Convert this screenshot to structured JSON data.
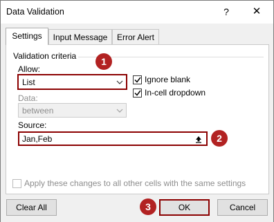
{
  "window": {
    "title": "Data Validation",
    "help": "?",
    "close": "✕"
  },
  "tabs": [
    {
      "label": "Settings",
      "active": true
    },
    {
      "label": "Input Message",
      "active": false
    },
    {
      "label": "Error Alert",
      "active": false
    }
  ],
  "group": {
    "label": "Validation criteria"
  },
  "allow": {
    "label": "Allow:",
    "value": "List"
  },
  "data": {
    "label": "Data:",
    "value": "between"
  },
  "ignore_blank": {
    "label": "Ignore blank",
    "checked": true
  },
  "in_cell_dropdown": {
    "label": "In-cell dropdown",
    "checked": true
  },
  "source": {
    "label": "Source:",
    "value": "Jan,Feb"
  },
  "apply_all": {
    "label": "Apply these changes to all other cells with the same settings",
    "checked": false
  },
  "buttons": {
    "clear_all": "Clear All",
    "ok": "OK",
    "cancel": "Cancel"
  },
  "badges": [
    "1",
    "2",
    "3"
  ],
  "colors": {
    "highlight": "#8b0000",
    "badge": "#b22222"
  }
}
